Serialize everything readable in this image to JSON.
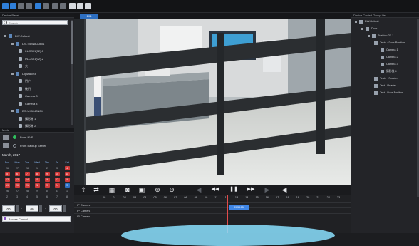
{
  "toolbar": {
    "buttons": [
      {
        "name": "layout-1x1-icon",
        "color": "blue"
      },
      {
        "name": "layout-2x2-icon",
        "color": "blue"
      },
      {
        "name": "layout-3x3-icon",
        "color": "grey"
      },
      {
        "name": "layout-4x4-icon",
        "color": "grey"
      },
      {
        "name": "playback-icon",
        "color": "blue"
      },
      {
        "name": "close-all-icon",
        "color": "grey"
      },
      {
        "name": "zoom-icon",
        "color": "grey"
      },
      {
        "name": "snapshot-icon",
        "color": "grey"
      },
      {
        "name": "settings-icon",
        "color": "white"
      },
      {
        "name": "user-icon",
        "color": "white"
      },
      {
        "name": "lock-icon",
        "color": "white"
      }
    ]
  },
  "tabs": {
    "active": "1X1"
  },
  "device_panel": {
    "title": "Device Panel",
    "search_placeholder": "Search",
    "tree": [
      {
        "label": "DW-Default",
        "level": 0,
        "type": "grp"
      },
      {
        "label": "DS-TB2N8G0801",
        "level": 1,
        "type": "grp"
      },
      {
        "label": "IN-CS01(02)-1",
        "level": 2,
        "type": "cam"
      },
      {
        "label": "IN-CS01(02)-2",
        "level": 2,
        "type": "cam"
      },
      {
        "label": "大",
        "level": 2,
        "type": "cam"
      },
      {
        "label": "Digiwatch4",
        "level": 1,
        "type": "grp"
      },
      {
        "label": "門户",
        "level": 2,
        "type": "cam"
      },
      {
        "label": "後門",
        "level": 2,
        "type": "cam"
      },
      {
        "label": "Camera 3",
        "level": 2,
        "type": "cam"
      },
      {
        "label": "Camera 4",
        "level": 2,
        "type": "cam"
      },
      {
        "label": "DS-VH8042N04",
        "level": 1,
        "type": "grp"
      },
      {
        "label": "攝影機 1",
        "level": 2,
        "type": "cam"
      },
      {
        "label": "攝影機 2",
        "level": 2,
        "type": "cam"
      },
      {
        "label": "攝影機 3",
        "level": 2,
        "type": "cam"
      }
    ]
  },
  "mode_panel": {
    "title": "Mode",
    "options": [
      {
        "label": "From NVR",
        "selected": true
      },
      {
        "label": "From Backup Server",
        "selected": false
      }
    ]
  },
  "calendar": {
    "title": "March, 2017",
    "weekdays": [
      "Sun",
      "Mon",
      "Tue",
      "Wed",
      "Thu",
      "Fri",
      "Sat"
    ],
    "weeks": [
      [
        "26",
        "27",
        "28",
        "1",
        "2",
        "3",
        "4"
      ],
      [
        "5",
        "6",
        "7",
        "8",
        "9",
        "10",
        "11"
      ],
      [
        "12",
        "13",
        "14",
        "15",
        "16",
        "17",
        "18"
      ],
      [
        "19",
        "20",
        "21",
        "22",
        "23",
        "24",
        "25"
      ],
      [
        "26",
        "27",
        "28",
        "29",
        "30",
        "31",
        "1"
      ],
      [
        "2",
        "3",
        "4",
        "5",
        "6",
        "7",
        "8"
      ]
    ],
    "recorded": [
      [
        0,
        6
      ],
      [
        1,
        0
      ],
      [
        1,
        1
      ],
      [
        1,
        2
      ],
      [
        1,
        3
      ],
      [
        1,
        4
      ],
      [
        1,
        5
      ],
      [
        1,
        6
      ],
      [
        2,
        0
      ],
      [
        2,
        1
      ],
      [
        2,
        2
      ],
      [
        2,
        3
      ],
      [
        2,
        4
      ],
      [
        2,
        5
      ],
      [
        2,
        6
      ],
      [
        3,
        0
      ],
      [
        3,
        1
      ],
      [
        3,
        2
      ],
      [
        3,
        3
      ],
      [
        3,
        4
      ],
      [
        3,
        5
      ],
      [
        3,
        6
      ]
    ],
    "selected": [
      [
        3,
        6
      ]
    ],
    "time": {
      "hh": "00",
      "mm": "00",
      "ss": "00"
    },
    "access_label": "Access Control"
  },
  "controls": {
    "buttons": [
      {
        "name": "export-icon",
        "glyph": "⇪",
        "dim": false
      },
      {
        "name": "sync-icon",
        "glyph": "⇄",
        "dim": false
      },
      {
        "name": "calendar-icon",
        "glyph": "▦",
        "dim": false
      },
      {
        "name": "camera-snapshot-icon",
        "glyph": "◙",
        "dim": false
      },
      {
        "name": "clip-icon",
        "glyph": "▣",
        "dim": false
      },
      {
        "name": "zoom-in-icon",
        "glyph": "⊕",
        "dim": false
      },
      {
        "name": "zoom-out-icon",
        "glyph": "⊖",
        "dim": false
      },
      {
        "name": "step-back-icon",
        "glyph": "◀",
        "dim": true
      },
      {
        "name": "rewind-icon",
        "glyph": "◀◀",
        "dim": false
      },
      {
        "name": "pause-icon",
        "glyph": "❚❚",
        "dim": false
      },
      {
        "name": "fast-forward-icon",
        "glyph": "▶▶",
        "dim": false
      },
      {
        "name": "step-forward-icon",
        "glyph": "▶",
        "dim": true
      },
      {
        "name": "volume-icon",
        "glyph": "◀",
        "dim": false
      }
    ]
  },
  "timeline": {
    "hours": [
      "00",
      "01",
      "02",
      "03",
      "04",
      "05",
      "06",
      "07",
      "08",
      "09",
      "10",
      "11",
      "12",
      "13",
      "14",
      "15",
      "16",
      "17",
      "18",
      "19",
      "20",
      "21",
      "22",
      "23"
    ],
    "lanes": [
      "IP Camera",
      "IP Camera",
      "IP Camera"
    ],
    "recording_label": "09:38:15"
  },
  "right_panel": {
    "title": "Device Control Group List",
    "tree": [
      {
        "label": "DW-Default",
        "level": 0
      },
      {
        "label": "Door",
        "level": 1
      },
      {
        "label": "Position 2E 1",
        "level": 2
      },
      {
        "label": "Test4 · Door Position",
        "level": 3
      },
      {
        "label": "Camera 1",
        "level": 4
      },
      {
        "label": "Camera 2",
        "level": 4
      },
      {
        "label": "Camera 3",
        "level": 4
      },
      {
        "label": "攝影機 4",
        "level": 4
      },
      {
        "label": "Test4 · Reader",
        "level": 3
      },
      {
        "label": "Test · Reader",
        "level": 3
      },
      {
        "label": "Test · Door Position",
        "level": 3
      }
    ]
  }
}
